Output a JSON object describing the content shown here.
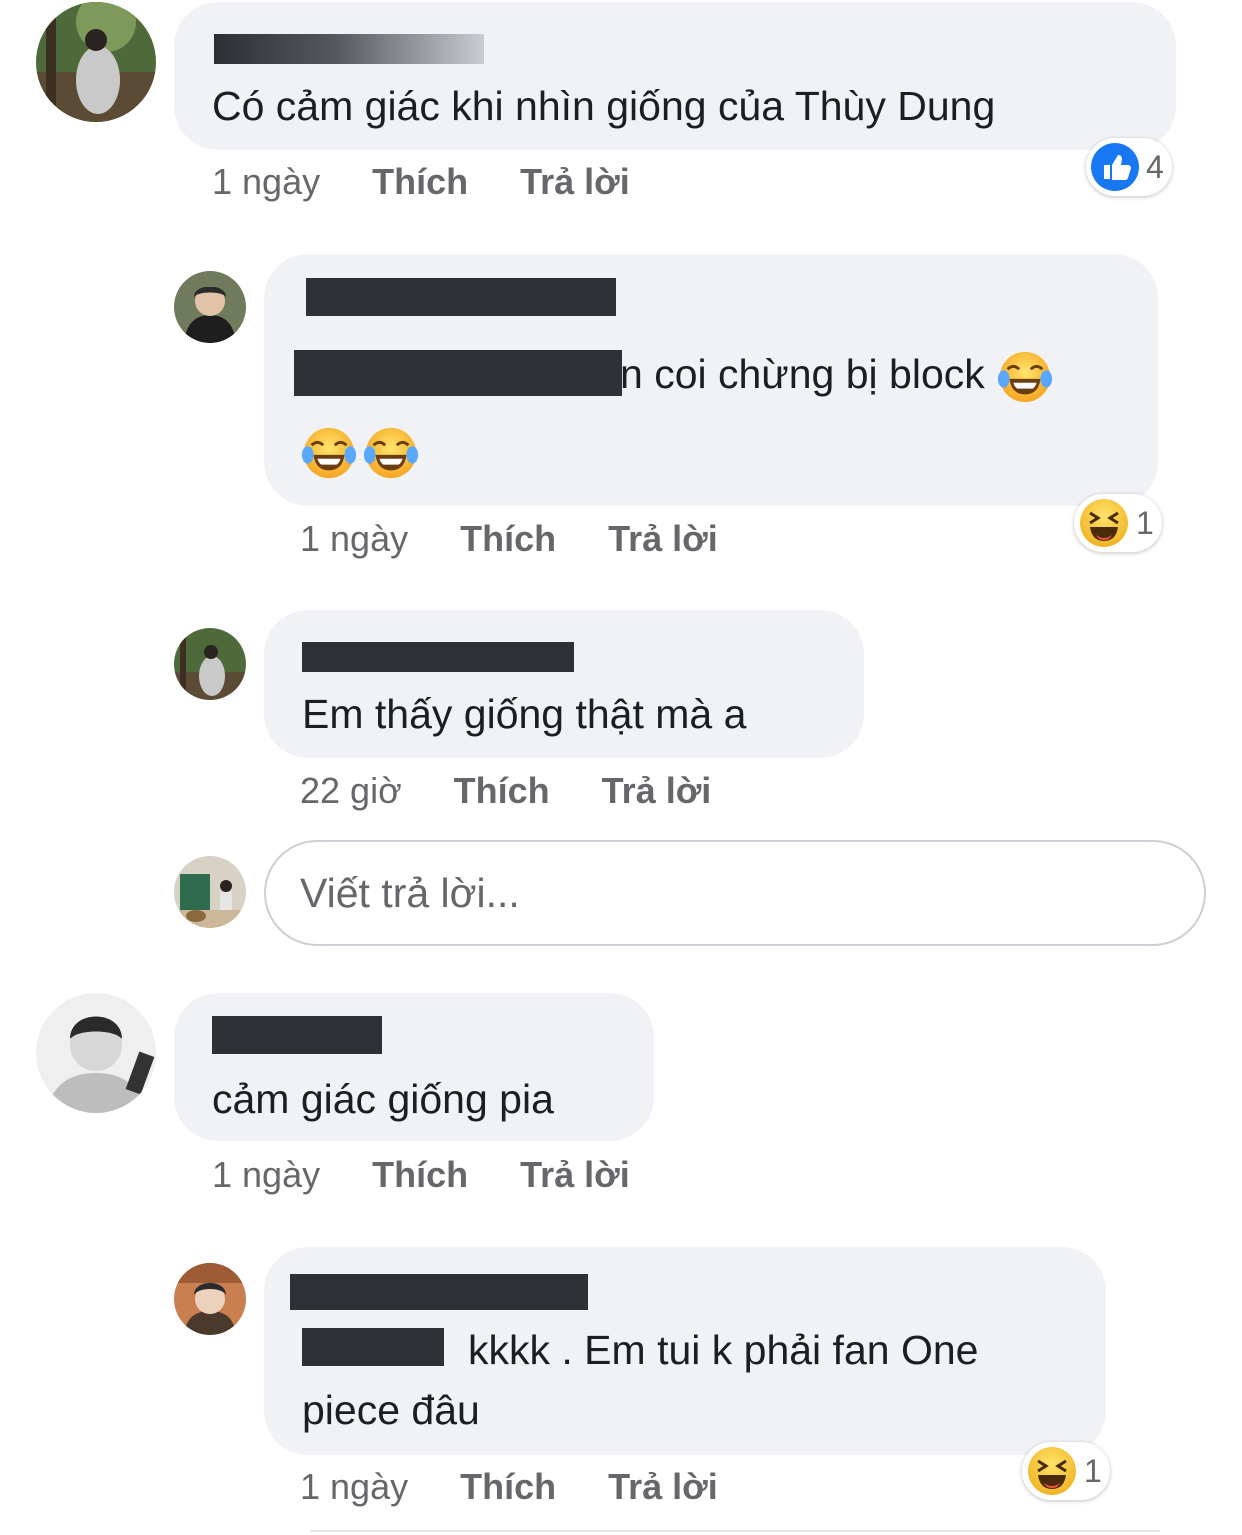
{
  "comments": [
    {
      "text": "Có cảm giác khi nhìn giống của Thùy Dung",
      "time": "1 ngày",
      "like": "Thích",
      "reply": "Trả lời",
      "reaction": {
        "icon": "like-icon",
        "count": "4"
      }
    },
    {
      "text_visible": "n coi chừng bị block",
      "emoji": "😂",
      "time": "1 ngày",
      "like": "Thích",
      "reply": "Trả lời",
      "reaction": {
        "icon": "haha-icon",
        "count": "1"
      }
    },
    {
      "text": "Em thấy giống thật mà a",
      "time": "22 giờ",
      "like": "Thích",
      "reply": "Trả lời"
    },
    {
      "text": "cảm giác giống pia",
      "time": "1 ngày",
      "like": "Thích",
      "reply": "Trả lời"
    },
    {
      "text_line1": "kkkk . Em tui k phải fan One",
      "text_line2": "piece đâu",
      "time": "1 ngày",
      "like": "Thích",
      "reply": "Trả lời",
      "reaction": {
        "icon": "haha-icon",
        "count": "1"
      }
    }
  ],
  "reply_box": {
    "placeholder": "Viết trả lời..."
  },
  "colors": {
    "bubble": "#f0f2f5",
    "meta": "#65676b",
    "like_blue": "#1877f2",
    "redaction": "#2e3136"
  }
}
